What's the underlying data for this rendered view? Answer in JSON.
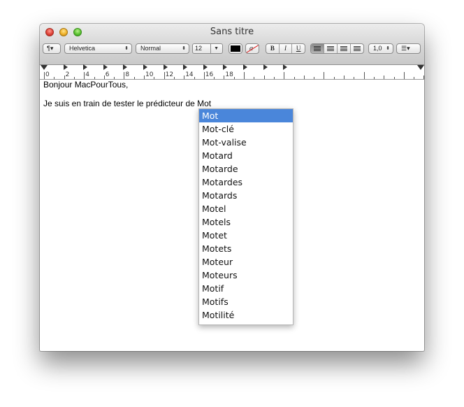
{
  "window": {
    "title": "Sans titre"
  },
  "toolbar": {
    "paragraph": "¶▾",
    "font_family": "Helvetica",
    "font_style": "Normal",
    "font_size": "12",
    "bold": "B",
    "italic": "I",
    "underline": "U",
    "line_spacing": "1,0",
    "list": "☰▾",
    "text_color": "#000000",
    "highlight_color": "#ffffff",
    "highlight_glyph": "a"
  },
  "ruler": {
    "labels": [
      "0",
      "2",
      "4",
      "6",
      "8",
      "10",
      "12",
      "14",
      "16",
      "18"
    ]
  },
  "document": {
    "line1": "Bonjour MacPourTous,",
    "line2": "Je suis en train de tester le prédicteur de Mot"
  },
  "completions": {
    "items": [
      "Mot",
      "Mot-clé",
      "Mot-valise",
      "Motard",
      "Motarde",
      "Motardes",
      "Motards",
      "Motel",
      "Motels",
      "Motet",
      "Motets",
      "Moteur",
      "Moteurs",
      "Motif",
      "Motifs",
      "Motilité"
    ],
    "selected_index": 0
  }
}
